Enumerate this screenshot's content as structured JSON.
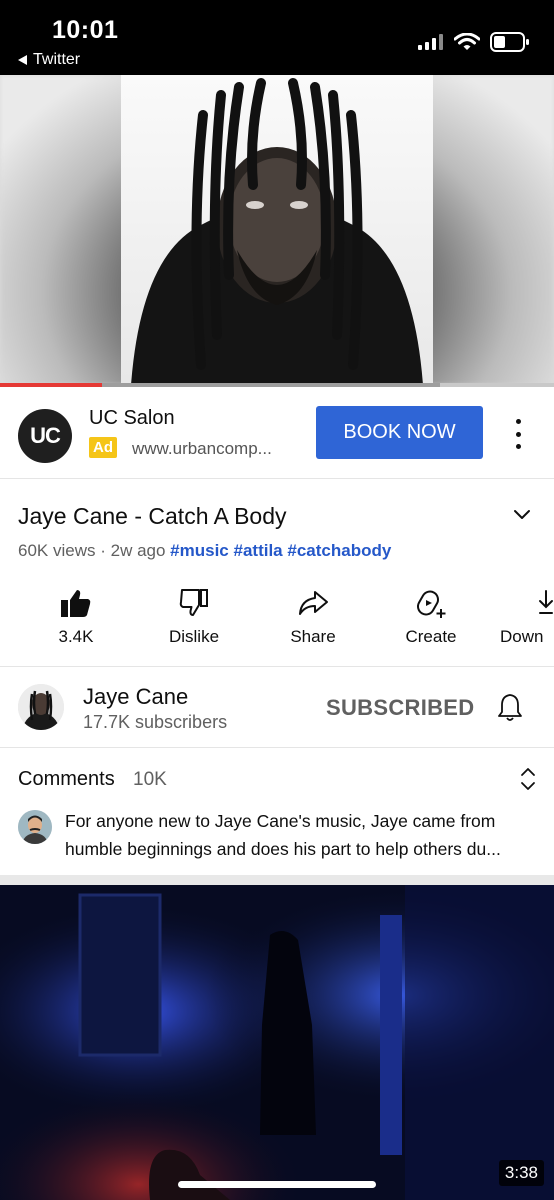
{
  "status_bar": {
    "time": "10:01",
    "back_app": "Twitter"
  },
  "player": {
    "progress_fraction": 0.185,
    "buffered_fraction": 0.795,
    "progress_color": "#e53935"
  },
  "ad": {
    "logo_text": "UC",
    "title": "UC Salon",
    "badge": "Ad",
    "url": "www.urbancomp...",
    "cta": "BOOK NOW",
    "cta_color": "#2f65d6"
  },
  "video": {
    "title": "Jaye Cane - Catch A Body",
    "views": "60K views",
    "age": "2w ago",
    "tags": [
      "#music",
      "#attila",
      "#catchabody"
    ]
  },
  "actions": [
    {
      "icon": "thumbs-up-icon",
      "label": "3.4K"
    },
    {
      "icon": "thumbs-down-icon",
      "label": "Dislike"
    },
    {
      "icon": "share-icon",
      "label": "Share"
    },
    {
      "icon": "create-icon",
      "label": "Create"
    },
    {
      "icon": "download-icon",
      "label": "Down"
    }
  ],
  "channel": {
    "name": "Jaye Cane",
    "subscribers": "17.7K subscribers",
    "subscribe_state": "SUBSCRIBED"
  },
  "comments": {
    "heading": "Comments",
    "count": "10K",
    "top_comment": "For anyone new to Jaye Cane's music, Jaye came from humble beginnings and does his part to help others du..."
  },
  "next_video": {
    "duration": "3:38"
  }
}
